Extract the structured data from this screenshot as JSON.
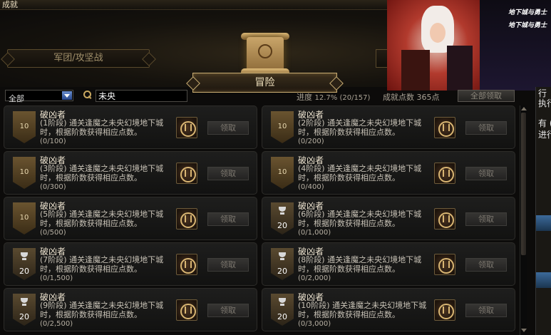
{
  "window": {
    "title": "成就"
  },
  "tabs": {
    "left": "军团/攻坚战",
    "active": "冒险"
  },
  "promo": {
    "logo_1": "地下城与勇士",
    "logo_2": "地下城与勇士"
  },
  "side_fragments": {
    "f1": "行",
    "f2": "执行",
    "f3": "有 (",
    "f4": "进行"
  },
  "filter": {
    "category_selected": "全部",
    "search_value": "未央"
  },
  "stats": {
    "progress_label": "进度",
    "progress_value": "12.7% (20/157)",
    "points_label": "成就点数",
    "points_value": "365点",
    "claim_all_label": "全部领取"
  },
  "achievements": [
    {
      "name": "破凶者",
      "desc": "(1阶段) 通关逢魔之未央幻境地下城时，根据阶数获得相应点数。",
      "count": "(0/100)",
      "points": "10",
      "trophy": false,
      "claim": "领取"
    },
    {
      "name": "破凶者",
      "desc": "(2阶段) 通关逢魔之未央幻境地下城时，根据阶数获得相应点数。",
      "count": "(0/200)",
      "points": "10",
      "trophy": false,
      "claim": "领取"
    },
    {
      "name": "破凶者",
      "desc": "(3阶段) 通关逢魔之未央幻境地下城时，根据阶数获得相应点数。",
      "count": "(0/300)",
      "points": "10",
      "trophy": false,
      "claim": "领取"
    },
    {
      "name": "破凶者",
      "desc": "(4阶段) 通关逢魔之未央幻境地下城时，根据阶数获得相应点数。",
      "count": "(0/400)",
      "points": "10",
      "trophy": false,
      "claim": "领取"
    },
    {
      "name": "破凶者",
      "desc": "(5阶段) 通关逢魔之未央幻境地下城时，根据阶数获得相应点数。",
      "count": "(0/500)",
      "points": "10",
      "trophy": false,
      "claim": "领取"
    },
    {
      "name": "破凶者",
      "desc": "(6阶段) 通关逢魔之未央幻境地下城时，根据阶数获得相应点数。",
      "count": "(0/1,000)",
      "points": "20",
      "trophy": true,
      "claim": "领取"
    },
    {
      "name": "破凶者",
      "desc": "(7阶段) 通关逢魔之未央幻境地下城时，根据阶数获得相应点数。",
      "count": "(0/1,500)",
      "points": "20",
      "trophy": true,
      "claim": "领取"
    },
    {
      "name": "破凶者",
      "desc": "(8阶段) 通关逢魔之未央幻境地下城时，根据阶数获得相应点数。",
      "count": "(0/2,000)",
      "points": "20",
      "trophy": true,
      "claim": "领取"
    },
    {
      "name": "破凶者",
      "desc": "(9阶段) 通关逢魔之未央幻境地下城时，根据阶数获得相应点数。",
      "count": "(0/2,500)",
      "points": "20",
      "trophy": true,
      "claim": "领取"
    },
    {
      "name": "破凶者",
      "desc": "(10阶段) 通关逢魔之未央幻境地下城时，根据阶数获得相应点数。",
      "count": "(0/3,000)",
      "points": "20",
      "trophy": true,
      "claim": "领取"
    }
  ]
}
